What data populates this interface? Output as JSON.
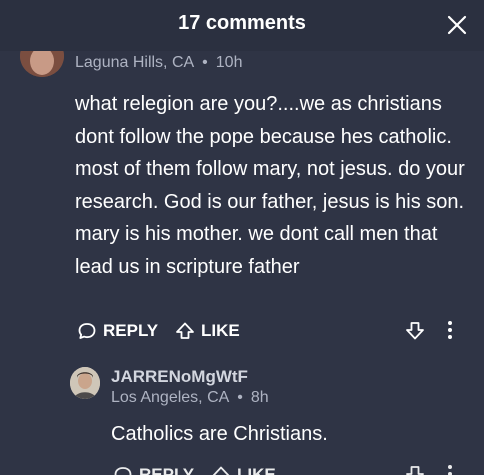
{
  "header": {
    "title": "17 comments"
  },
  "comment": {
    "location": "Laguna Hills, CA",
    "separator": "•",
    "time": "10h",
    "body": "what relegion are you?....we as christians dont follow the pope because hes catholic. most of them follow mary, not jesus. do your research. God is our father, jesus is his son. mary is his mother. we dont call men that lead us in scripture father",
    "actions": {
      "reply_label": "REPLY",
      "like_label": "LIKE"
    }
  },
  "reply": {
    "username": "JARRENoMgWtF",
    "location": "Los Angeles, CA",
    "separator": "•",
    "time": "8h",
    "body": "Catholics are Christians.",
    "actions": {
      "reply_label": "REPLY",
      "like_label": "LIKE"
    }
  },
  "colors": {
    "background": "#2f3445",
    "header": "#2b3040",
    "muted_text": "#aeb3c2"
  },
  "icons": [
    "close-icon",
    "reply-bubble-icon",
    "upvote-arrow-icon",
    "downvote-arrow-icon",
    "more-vertical-icon"
  ]
}
